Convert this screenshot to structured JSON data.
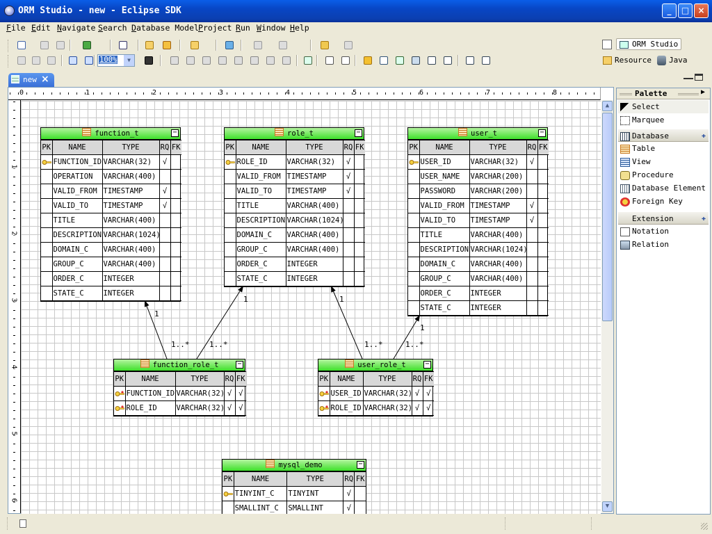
{
  "window": {
    "title": "ORM Studio - new - Eclipse SDK"
  },
  "menu": [
    "File",
    "Edit",
    "Navigate",
    "Search",
    "Database Model",
    "Project",
    "Run",
    "Window",
    "Help"
  ],
  "toolbar": {
    "zoom": "100%"
  },
  "perspectives": [
    {
      "label": "ORM Studio",
      "active": true
    },
    {
      "label": "Resource",
      "active": false
    },
    {
      "label": "Java",
      "active": false
    }
  ],
  "editor": {
    "tab_label": "new"
  },
  "ruler": {
    "top_labels": [
      "1",
      "2",
      "3",
      "4",
      "5",
      "6",
      "7",
      "8"
    ],
    "left_labels": [
      "1",
      "2",
      "3",
      "4",
      "5",
      "6"
    ]
  },
  "columns": {
    "pk": "PK",
    "name": "NAME",
    "type": "TYPE",
    "rq": "RQ",
    "fk": "FK"
  },
  "check_mark": "√",
  "tables": {
    "function_t": {
      "name": "function_t",
      "rows": [
        {
          "pk": true,
          "name": "FUNCTION_ID",
          "type": "VARCHAR(32)",
          "rq": true,
          "fk": false
        },
        {
          "pk": false,
          "name": "OPERATION",
          "type": "VARCHAR(400)",
          "rq": false,
          "fk": false
        },
        {
          "pk": false,
          "name": "VALID_FROM",
          "type": "TIMESTAMP",
          "rq": true,
          "fk": false
        },
        {
          "pk": false,
          "name": "VALID_TO",
          "type": "TIMESTAMP",
          "rq": true,
          "fk": false
        },
        {
          "pk": false,
          "name": "TITLE",
          "type": "VARCHAR(400)",
          "rq": false,
          "fk": false
        },
        {
          "pk": false,
          "name": "DESCRIPTION",
          "type": "VARCHAR(1024)",
          "rq": false,
          "fk": false
        },
        {
          "pk": false,
          "name": "DOMAIN_C",
          "type": "VARCHAR(400)",
          "rq": false,
          "fk": false
        },
        {
          "pk": false,
          "name": "GROUP_C",
          "type": "VARCHAR(400)",
          "rq": false,
          "fk": false
        },
        {
          "pk": false,
          "name": "ORDER_C",
          "type": "INTEGER",
          "rq": false,
          "fk": false
        },
        {
          "pk": false,
          "name": "STATE_C",
          "type": "INTEGER",
          "rq": false,
          "fk": false
        }
      ]
    },
    "role_t": {
      "name": "role_t",
      "rows": [
        {
          "pk": true,
          "name": "ROLE_ID",
          "type": "VARCHAR(32)",
          "rq": true,
          "fk": false
        },
        {
          "pk": false,
          "name": "VALID_FROM",
          "type": "TIMESTAMP",
          "rq": true,
          "fk": false
        },
        {
          "pk": false,
          "name": "VALID_TO",
          "type": "TIMESTAMP",
          "rq": true,
          "fk": false
        },
        {
          "pk": false,
          "name": "TITLE",
          "type": "VARCHAR(400)",
          "rq": false,
          "fk": false
        },
        {
          "pk": false,
          "name": "DESCRIPTION",
          "type": "VARCHAR(1024)",
          "rq": false,
          "fk": false
        },
        {
          "pk": false,
          "name": "DOMAIN_C",
          "type": "VARCHAR(400)",
          "rq": false,
          "fk": false
        },
        {
          "pk": false,
          "name": "GROUP_C",
          "type": "VARCHAR(400)",
          "rq": false,
          "fk": false
        },
        {
          "pk": false,
          "name": "ORDER_C",
          "type": "INTEGER",
          "rq": false,
          "fk": false
        },
        {
          "pk": false,
          "name": "STATE_C",
          "type": "INTEGER",
          "rq": false,
          "fk": false
        }
      ]
    },
    "user_t": {
      "name": "user_t",
      "rows": [
        {
          "pk": true,
          "name": "USER_ID",
          "type": "VARCHAR(32)",
          "rq": true,
          "fk": false
        },
        {
          "pk": false,
          "name": "USER_NAME",
          "type": "VARCHAR(200)",
          "rq": false,
          "fk": false
        },
        {
          "pk": false,
          "name": "PASSWORD",
          "type": "VARCHAR(200)",
          "rq": false,
          "fk": false
        },
        {
          "pk": false,
          "name": "VALID_FROM",
          "type": "TIMESTAMP",
          "rq": true,
          "fk": false
        },
        {
          "pk": false,
          "name": "VALID_TO",
          "type": "TIMESTAMP",
          "rq": true,
          "fk": false
        },
        {
          "pk": false,
          "name": "TITLE",
          "type": "VARCHAR(400)",
          "rq": false,
          "fk": false
        },
        {
          "pk": false,
          "name": "DESCRIPTION",
          "type": "VARCHAR(1024)",
          "rq": false,
          "fk": false
        },
        {
          "pk": false,
          "name": "DOMAIN_C",
          "type": "VARCHAR(400)",
          "rq": false,
          "fk": false
        },
        {
          "pk": false,
          "name": "GROUP_C",
          "type": "VARCHAR(400)",
          "rq": false,
          "fk": false
        },
        {
          "pk": false,
          "name": "ORDER_C",
          "type": "INTEGER",
          "rq": false,
          "fk": false
        },
        {
          "pk": false,
          "name": "STATE_C",
          "type": "INTEGER",
          "rq": false,
          "fk": false
        }
      ]
    },
    "function_role_t": {
      "name": "function_role_t",
      "rows": [
        {
          "pk": true,
          "name": "FUNCTION_ID",
          "type": "VARCHAR(32)",
          "rq": true,
          "fk": true
        },
        {
          "pk": true,
          "name": "ROLE_ID",
          "type": "VARCHAR(32)",
          "rq": true,
          "fk": true
        }
      ]
    },
    "user_role_t": {
      "name": "user_role_t",
      "rows": [
        {
          "pk": true,
          "name": "USER_ID",
          "type": "VARCHAR(32)",
          "rq": true,
          "fk": true
        },
        {
          "pk": true,
          "name": "ROLE_ID",
          "type": "VARCHAR(32)",
          "rq": true,
          "fk": true
        }
      ]
    },
    "mysql_demo": {
      "name": "mysql_demo",
      "rows": [
        {
          "pk": true,
          "name": "TINYINT_C",
          "type": "TINYINT",
          "rq": true,
          "fk": false
        },
        {
          "pk": false,
          "name": "SMALLINT_C",
          "type": "SMALLINT",
          "rq": true,
          "fk": false
        }
      ]
    }
  },
  "relations": [
    {
      "from": "function_role_t",
      "to": "function_t",
      "source_card": "1..*",
      "target_card": "1"
    },
    {
      "from": "function_role_t",
      "to": "role_t",
      "source_card": "1..*",
      "target_card": "1"
    },
    {
      "from": "user_role_t",
      "to": "role_t",
      "source_card": "1..*",
      "target_card": "1"
    },
    {
      "from": "user_role_t",
      "to": "user_t",
      "source_card": "1..*",
      "target_card": "1"
    }
  ],
  "palette": {
    "title": "Palette",
    "tools": [
      {
        "label": "Select",
        "icon": "arrow-cursor-icon"
      },
      {
        "label": "Marquee",
        "icon": "marquee-icon"
      }
    ],
    "drawers": [
      {
        "label": "Database",
        "items": [
          {
            "label": "Table",
            "icon": "table-icon"
          },
          {
            "label": "View",
            "icon": "view-icon"
          },
          {
            "label": "Procedure",
            "icon": "procedure-icon"
          },
          {
            "label": "Database Element",
            "icon": "database-element-icon"
          },
          {
            "label": "Foreign Key",
            "icon": "foreign-key-icon"
          }
        ]
      },
      {
        "label": "Extension",
        "items": [
          {
            "label": "Notation",
            "icon": "notation-icon"
          },
          {
            "label": "Relation",
            "icon": "relation-icon"
          }
        ]
      }
    ]
  },
  "colors": {
    "title_bar": "#0a4fd4",
    "table_header": "#3ee02a",
    "grid": "#c8c8c8",
    "chrome": "#ece9d8"
  }
}
